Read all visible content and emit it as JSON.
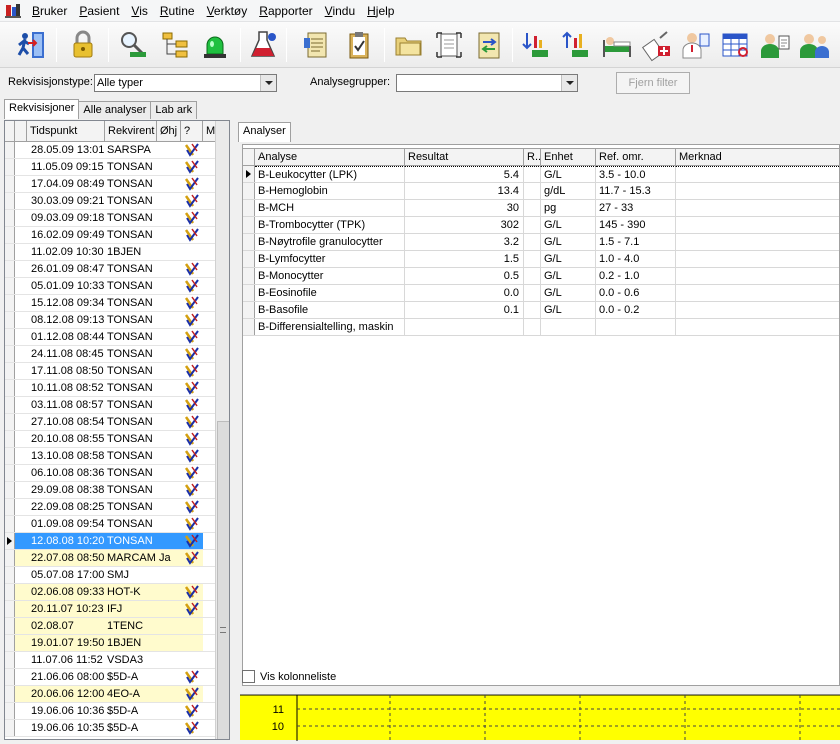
{
  "menu": [
    "Bruker",
    "Pasient",
    "Vis",
    "Rutine",
    "Verktøy",
    "Rapporter",
    "Vindu",
    "Hjelp"
  ],
  "toolbar_icons": [
    "exit-icon",
    "lock-icon",
    "search-patient-icon",
    "tree-icon",
    "alarm-light-icon",
    "flask-icon",
    "document-list-icon",
    "clipboard-icon",
    "folder-icon",
    "scan-icon",
    "transfer-icon",
    "sort-down-icon",
    "sort-up-icon",
    "bed-icon",
    "syringe-icon",
    "doctor-icon",
    "table-icon",
    "nurse-icon",
    "team-icon"
  ],
  "filters": {
    "type_label": "Rekvisisjonstype:",
    "type_value": "Alle typer",
    "groups_label": "Analysegrupper:",
    "groups_value": "",
    "clear_button": "Fjern filter"
  },
  "left_tabs": [
    "Rekvisisjoner",
    "Alle analyser",
    "Lab ark"
  ],
  "list_headers": [
    "Tidspunkt",
    "Rekvirent",
    "Øhj",
    "?",
    "M"
  ],
  "requisitions": [
    {
      "time": "28.05.09 13:01",
      "req": "SARSPA",
      "ohj": "",
      "check": true,
      "style": ""
    },
    {
      "time": "11.05.09 09:15",
      "req": "TONSAN",
      "ohj": "",
      "check": true,
      "style": ""
    },
    {
      "time": "17.04.09 08:49",
      "req": "TONSAN",
      "ohj": "",
      "check": true,
      "style": ""
    },
    {
      "time": "30.03.09 09:21",
      "req": "TONSAN",
      "ohj": "",
      "check": true,
      "style": ""
    },
    {
      "time": "09.03.09 09:18",
      "req": "TONSAN",
      "ohj": "",
      "check": true,
      "style": ""
    },
    {
      "time": "16.02.09 09:49",
      "req": "TONSAN",
      "ohj": "",
      "check": true,
      "style": ""
    },
    {
      "time": "11.02.09 10:30",
      "req": "1BJEN",
      "ohj": "",
      "check": false,
      "style": ""
    },
    {
      "time": "26.01.09 08:47",
      "req": "TONSAN",
      "ohj": "",
      "check": true,
      "style": ""
    },
    {
      "time": "05.01.09 10:33",
      "req": "TONSAN",
      "ohj": "",
      "check": true,
      "style": ""
    },
    {
      "time": "15.12.08 09:34",
      "req": "TONSAN",
      "ohj": "",
      "check": true,
      "style": ""
    },
    {
      "time": "08.12.08 09:13",
      "req": "TONSAN",
      "ohj": "",
      "check": true,
      "style": ""
    },
    {
      "time": "01.12.08 08:44",
      "req": "TONSAN",
      "ohj": "",
      "check": true,
      "style": ""
    },
    {
      "time": "24.11.08 08:45",
      "req": "TONSAN",
      "ohj": "",
      "check": true,
      "style": ""
    },
    {
      "time": "17.11.08 08:50",
      "req": "TONSAN",
      "ohj": "",
      "check": true,
      "style": ""
    },
    {
      "time": "10.11.08 08:52",
      "req": "TONSAN",
      "ohj": "",
      "check": true,
      "style": ""
    },
    {
      "time": "03.11.08 08:57",
      "req": "TONSAN",
      "ohj": "",
      "check": true,
      "style": ""
    },
    {
      "time": "27.10.08 08:54",
      "req": "TONSAN",
      "ohj": "",
      "check": true,
      "style": ""
    },
    {
      "time": "20.10.08 08:55",
      "req": "TONSAN",
      "ohj": "",
      "check": true,
      "style": ""
    },
    {
      "time": "13.10.08 08:58",
      "req": "TONSAN",
      "ohj": "",
      "check": true,
      "style": ""
    },
    {
      "time": "06.10.08 08:36",
      "req": "TONSAN",
      "ohj": "",
      "check": true,
      "style": ""
    },
    {
      "time": "29.09.08 08:38",
      "req": "TONSAN",
      "ohj": "",
      "check": true,
      "style": ""
    },
    {
      "time": "22.09.08 08:25",
      "req": "TONSAN",
      "ohj": "",
      "check": true,
      "style": ""
    },
    {
      "time": "01.09.08 09:54",
      "req": "TONSAN",
      "ohj": "",
      "check": true,
      "style": ""
    },
    {
      "time": "12.08.08 10:20",
      "req": "TONSAN",
      "ohj": "",
      "check": true,
      "style": "current"
    },
    {
      "time": "22.07.08 08:50",
      "req": "MARCAM",
      "ohj": "Ja",
      "check": true,
      "style": "yellow"
    },
    {
      "time": "05.07.08 17:00",
      "req": "SMJ",
      "ohj": "",
      "check": false,
      "style": ""
    },
    {
      "time": "02.06.08 09:33",
      "req": "HOT-K",
      "ohj": "",
      "check": true,
      "style": "yellow"
    },
    {
      "time": "20.11.07 10:23",
      "req": "IFJ",
      "ohj": "",
      "check": true,
      "style": "yellow"
    },
    {
      "time": "02.08.07",
      "req": "1TENC",
      "ohj": "",
      "check": false,
      "style": "yellow"
    },
    {
      "time": "19.01.07 19:50",
      "req": "1BJEN",
      "ohj": "",
      "check": false,
      "style": "yellow"
    },
    {
      "time": "11.07.06 11:52",
      "req": "VSDA3",
      "ohj": "",
      "check": false,
      "style": ""
    },
    {
      "time": "21.06.06 08:00",
      "req": "$5D-A",
      "ohj": "",
      "check": true,
      "style": ""
    },
    {
      "time": "20.06.06 12:00",
      "req": "4EO-A",
      "ohj": "",
      "check": true,
      "style": "yellow"
    },
    {
      "time": "19.06.06 10:36",
      "req": "$5D-A",
      "ohj": "",
      "check": true,
      "style": ""
    },
    {
      "time": "19.06.06 10:35",
      "req": "$5D-A",
      "ohj": "",
      "check": true,
      "style": ""
    }
  ],
  "right_tab": "Analyser",
  "analysis_headers": [
    "Analyse",
    "Resultat",
    "R..",
    "Enhet",
    "Ref. omr.",
    "Merknad"
  ],
  "analyses": [
    {
      "name": "B-Leukocytter (LPK)",
      "result": "5.4",
      "unit": "G/L",
      "ref": "3.5 - 10.0"
    },
    {
      "name": "B-Hemoglobin",
      "result": "13.4",
      "unit": "g/dL",
      "ref": "11.7 - 15.3"
    },
    {
      "name": "B-MCH",
      "result": "30",
      "unit": "pg",
      "ref": "27 - 33"
    },
    {
      "name": "B-Trombocytter (TPK)",
      "result": "302",
      "unit": "G/L",
      "ref": "145 - 390"
    },
    {
      "name": "B-Nøytrofile granulocytter",
      "result": "3.2",
      "unit": "G/L",
      "ref": "1.5 - 7.1"
    },
    {
      "name": "B-Lymfocytter",
      "result": "1.5",
      "unit": "G/L",
      "ref": "1.0 - 4.0"
    },
    {
      "name": "B-Monocytter",
      "result": "0.5",
      "unit": "G/L",
      "ref": "0.2 - 1.0"
    },
    {
      "name": "B-Eosinofile",
      "result": "0.0",
      "unit": "G/L",
      "ref": "0.0 - 0.6"
    },
    {
      "name": "B-Basofile",
      "result": "0.1",
      "unit": "G/L",
      "ref": "0.0 - 0.2"
    },
    {
      "name": "B-Differensialtelling, maskin",
      "result": "",
      "unit": "",
      "ref": ""
    }
  ],
  "show_columns_label": "Vis kolonneliste",
  "chart": {
    "tick_labels": [
      "11",
      "10"
    ],
    "background": "#ffff00"
  }
}
